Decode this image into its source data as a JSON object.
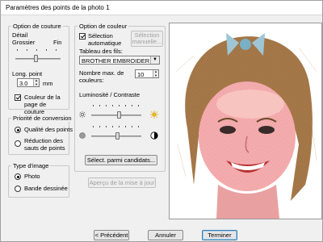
{
  "window": {
    "title": "Paramètres des points de la photo 1"
  },
  "stitch_option": {
    "legend": "Option de couture",
    "detail_label": "Détail",
    "coarse_label": "Grossier",
    "fine_label": "Fin",
    "length_label": "Long. point",
    "length_value": "3.0",
    "length_unit": "mm",
    "page_color_label": "Couleur de la page de couture",
    "page_color_checked": true
  },
  "conversion_priority": {
    "legend": "Priorité de conversion",
    "options": [
      "Qualité des points",
      "Réduction des sauts de points"
    ],
    "selected": 0
  },
  "image_type": {
    "legend": "Type d'image",
    "options": [
      "Photo",
      "Bande dessinée"
    ],
    "selected": 0
  },
  "color_option": {
    "legend": "Option de couleur",
    "auto_select_label": "Sélection automatique",
    "auto_select_checked": true,
    "manual_select_button": "Sélection manuelle...",
    "thread_chart_label": "Tableau des fils:",
    "thread_chart_value": "BROTHER EMBROIDERY",
    "max_colors_label": "Nombre max. de couleurs:",
    "max_colors_value": "10",
    "brightness_contrast_label": "Luminosité / Contraste",
    "choose_candidates_button": "Sélect. parmi candidats..."
  },
  "preview_update_button": "Aperçu de la mise à jour",
  "footer": {
    "previous_button": "< Précédent",
    "cancel_button": "Annuler",
    "finish_button": "Terminer"
  },
  "icons": {
    "brightness": "sun-icon",
    "contrast": "contrast-icon"
  },
  "sliders": {
    "detail_level": 0.5,
    "brightness_level": 0.55,
    "contrast_level": 0.52
  }
}
